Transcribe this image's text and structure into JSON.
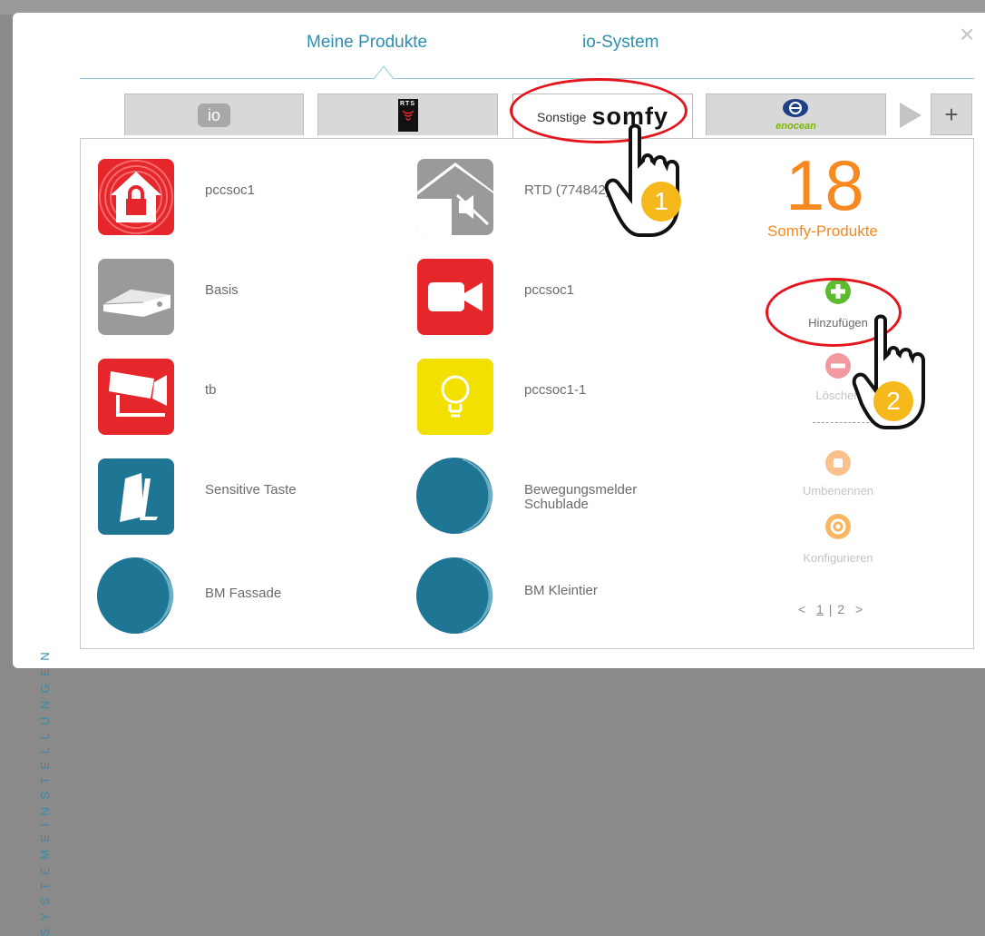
{
  "header": {
    "tab_products": "Meine Produkte",
    "tab_system": "io-System",
    "close": "×"
  },
  "sidebar": {
    "vertical_label": "SYSTEMEINSTELLUNGEN"
  },
  "protocol_tabs": {
    "io": "io",
    "rts": "RTS",
    "somfy_prefix": "Sonstige",
    "somfy_logo": "somfy",
    "enocean": "enocean",
    "add": "+"
  },
  "products": [
    {
      "label": "pccsoc1",
      "icon": "alarm-house-icon",
      "color": "#e5262b"
    },
    {
      "label": "RTD (774842)",
      "icon": "house-sensor-icon",
      "color": "#9a9a9a"
    },
    {
      "label": "Basis",
      "icon": "base-station-icon",
      "color": "#9a9a9a"
    },
    {
      "label": "pccsoc1",
      "icon": "video-camera-icon",
      "color": "#e5262b"
    },
    {
      "label": "tb",
      "icon": "security-camera-icon",
      "color": "#e5262b"
    },
    {
      "label": "pccsoc1-1",
      "icon": "light-bulb-icon",
      "color": "#f2e000"
    },
    {
      "label": "Sensitive Taste",
      "icon": "sensitive-key-icon",
      "color": "#1f7594"
    },
    {
      "label_line1": "Bewegungsmelder",
      "label_line2": "Schublade",
      "icon": "motion-sensor-icon",
      "color": "#1f7594"
    },
    {
      "label": "BM Fassade",
      "icon": "motion-sensor-icon",
      "color": "#1f7594"
    },
    {
      "label": "BM Kleintier",
      "icon": "motion-sensor-icon",
      "color": "#1f7594"
    }
  ],
  "summary": {
    "count": "18",
    "count_label": "Somfy-Produkte"
  },
  "actions": {
    "add": "Hinzufügen",
    "delete": "Löschen",
    "rename": "Umbenennen",
    "configure": "Konfigurieren"
  },
  "pagination": {
    "prev": "<",
    "page1": "1",
    "sep": "|",
    "page2": "2",
    "next": ">"
  },
  "annotations": {
    "step1": "1",
    "step2": "2"
  },
  "colors": {
    "accent": "#2c8fb1",
    "orange": "#f6891f",
    "red": "#e5151d",
    "green": "#5dbb2e",
    "badge": "#f6b91b"
  }
}
